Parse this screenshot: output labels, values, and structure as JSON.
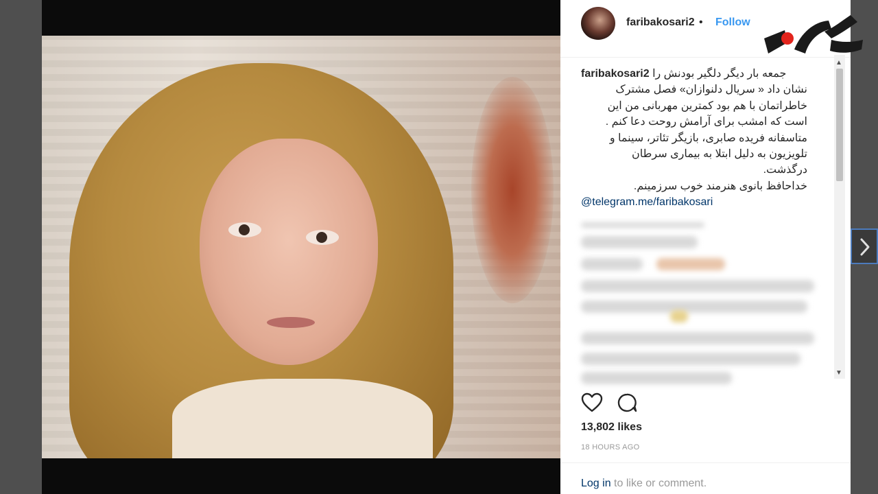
{
  "post": {
    "username": "faribakosari2",
    "separator": "•",
    "follow_label": "Follow",
    "caption": {
      "author": "faribakosari2",
      "first_line": "جمعه بار دیگر دلگیر بودنش را",
      "lines": [
        "نشان داد « سریال دلنوازان» فصل مشترک",
        "خاطراتمان با هم بود کمترین مهربانی من این",
        "است که امشب برای آرامش روحت دعا کنم .",
        "متاسفانه فریده صابری، بازیگر تئاتر، سینما و",
        "تلویزیون به دلیل ابتلا به بیماری سرطان",
        "درگذشت.",
        "خداحافظ بانوی هنرمند خوب سرزمینم."
      ],
      "link": "@telegram.me/faribakosari"
    },
    "likes": "13,802 likes",
    "time": "18 HOURS AGO",
    "login_link": "Log in",
    "login_rest": " to like or comment."
  },
  "icons": {
    "like": "heart-outline-icon",
    "comment": "speech-bubble-icon",
    "next": "chevron-right-icon"
  },
  "colors": {
    "follow": "#3897f0",
    "link": "#003569",
    "logo_red": "#e2241c",
    "logo_dark": "#1a1a1a"
  }
}
